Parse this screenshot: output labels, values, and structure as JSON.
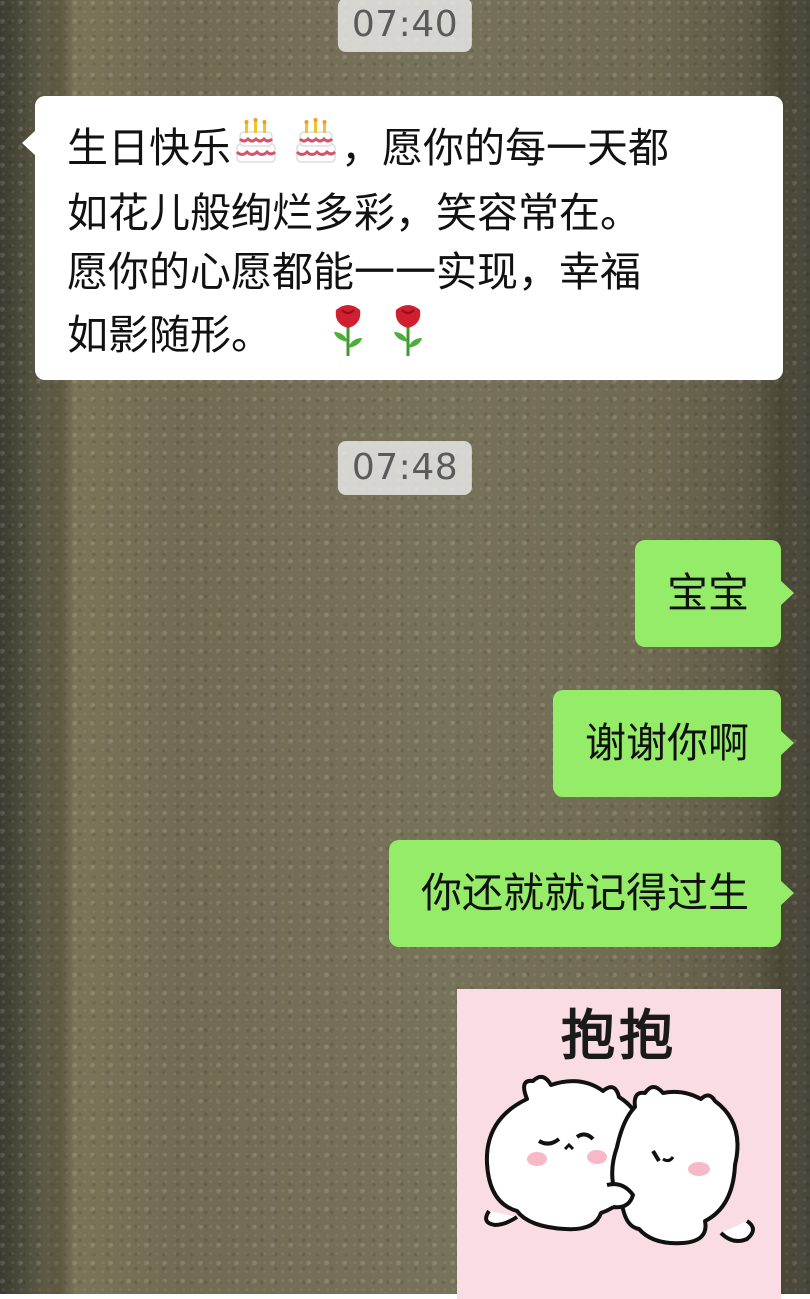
{
  "chat": {
    "timestamps": [
      "07:40",
      "07:48"
    ],
    "incoming": {
      "line1_start": "生日快乐",
      "line1_end": "，愿你的每一天都",
      "line2": "如花儿般绚烂多彩，笑容常在。",
      "line3": "愿你的心愿都能一一实现，幸福",
      "line4": "如影随形。",
      "emojis": [
        "cake",
        "cake",
        "rose",
        "rose"
      ]
    },
    "outgoing": [
      "宝宝",
      "谢谢你啊",
      "你还就就记得过生"
    ],
    "sticker": {
      "caption": "抱抱"
    }
  },
  "colors": {
    "incoming_bubble": "#ffffff",
    "outgoing_bubble": "#95ec69",
    "timestamp_pill": "#ececec",
    "sticker_bg": "#fadce4"
  }
}
